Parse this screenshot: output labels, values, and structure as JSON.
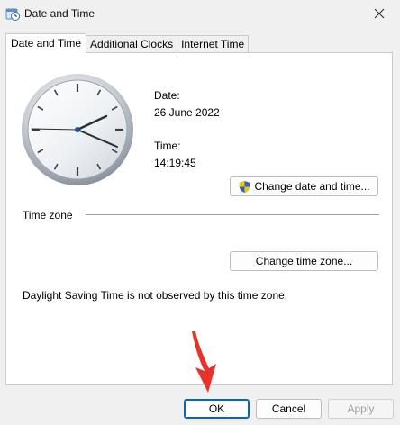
{
  "window": {
    "title": "Date and Time",
    "close_icon": "close-icon"
  },
  "tabs": [
    {
      "label": "Date and Time",
      "active": true
    },
    {
      "label": "Additional Clocks",
      "active": false
    },
    {
      "label": "Internet Time",
      "active": false
    }
  ],
  "date_section": {
    "date_label": "Date:",
    "date_value": "26 June 2022",
    "time_label": "Time:",
    "time_value": "14:19:45",
    "change_button": "Change date and time..."
  },
  "timezone": {
    "heading": "Time zone",
    "change_button": "Change time zone...",
    "dst_note": "Daylight Saving Time is not observed by this time zone."
  },
  "footer": {
    "ok": "OK",
    "cancel": "Cancel",
    "apply": "Apply"
  },
  "colors": {
    "accent": "#0067c0",
    "arrow": "#e8332a"
  }
}
